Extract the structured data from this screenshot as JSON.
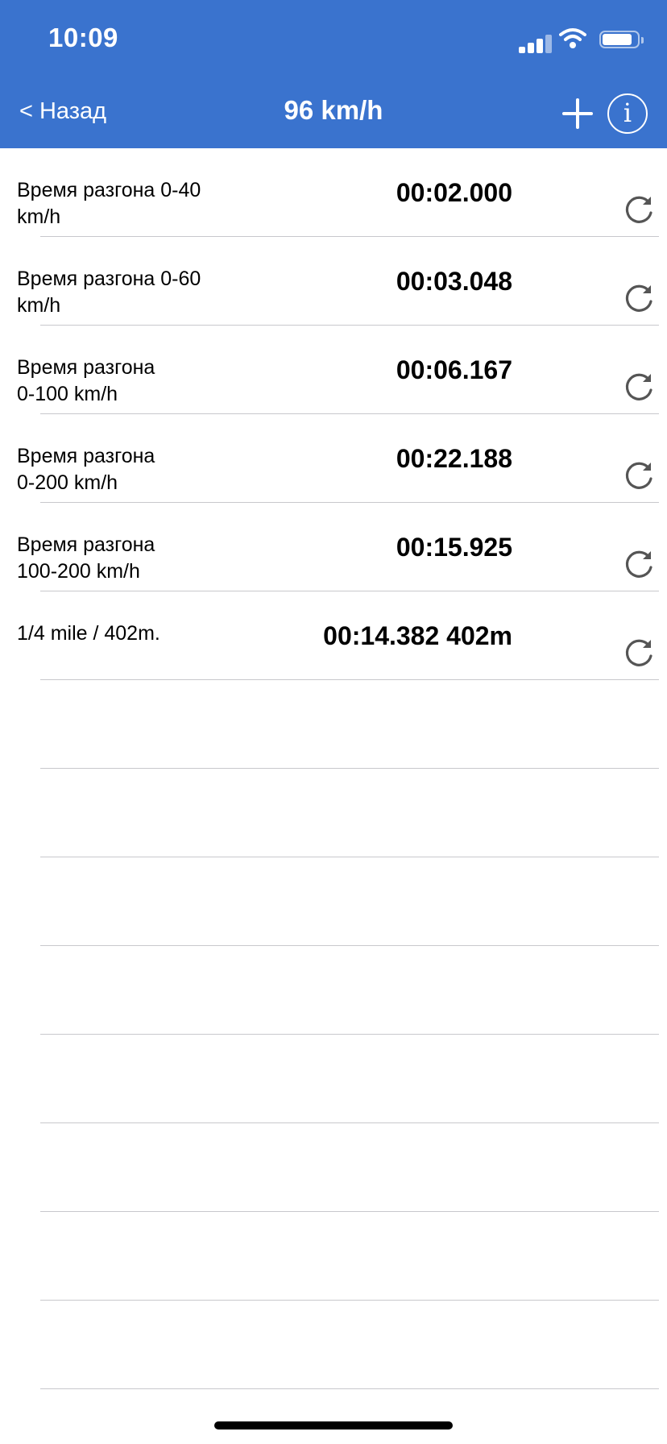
{
  "status_bar": {
    "time": "10:09",
    "icons": [
      "signal-icon",
      "wifi-icon",
      "battery-icon"
    ]
  },
  "nav": {
    "back_label": "< Назад",
    "title": "96  km/h",
    "add_icon": "plus-icon",
    "info_label": "i"
  },
  "colors": {
    "header_bg": "#3A73CE",
    "separator": "#C8C8CC",
    "reset_icon": "#555555"
  },
  "results": [
    {
      "label_line1": "Время разгона  0-40",
      "label_line2": "km/h",
      "value": "00:02.000"
    },
    {
      "label_line1": "Время разгона  0-60",
      "label_line2": "km/h",
      "value": "00:03.048"
    },
    {
      "label_line1": "Время разгона",
      "label_line2": "0-100 km/h",
      "value": "00:06.167"
    },
    {
      "label_line1": "Время разгона",
      "label_line2": "0-200 km/h",
      "value": "00:22.188"
    },
    {
      "label_line1": "Время разгона",
      "label_line2": "100-200 km/h",
      "value": "00:15.925"
    },
    {
      "label_line1": "1/4 mile / 402m.",
      "label_line2": "",
      "value": "00:14.382 402m"
    }
  ]
}
